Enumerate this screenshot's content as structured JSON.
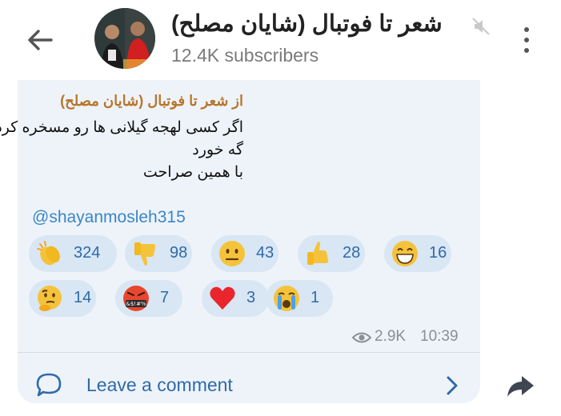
{
  "header": {
    "title": "شعر تا فوتبال (شایان مصلح)",
    "subscribers": "12.4K subscribers"
  },
  "message": {
    "forwarded_from": "از شعر تا فوتبال (شایان مصلح)",
    "lines": [
      "اگر کسی لهجه گیلانی ها رو مسخره کرد",
      "گه خورد",
      "با همین صراحت"
    ],
    "mention": "@shayanmosleh315",
    "reactions": [
      {
        "emoji": "clapping-hands",
        "count": "324"
      },
      {
        "emoji": "thumbs-down",
        "count": "98"
      },
      {
        "emoji": "neutral-face",
        "count": "43"
      },
      {
        "emoji": "thumbs-up",
        "count": "28"
      },
      {
        "emoji": "grinning-face",
        "count": "16"
      },
      {
        "emoji": "thinking-face",
        "count": "14"
      },
      {
        "emoji": "cursing-face",
        "count": "7"
      },
      {
        "emoji": "red-heart",
        "count": "3"
      },
      {
        "emoji": "crying-face",
        "count": "1"
      }
    ],
    "cursing_symbols": "&$!#%",
    "views": "2.9K",
    "time": "10:39"
  },
  "comments": {
    "label": "Leave a comment"
  },
  "colors": {
    "bubble": "#eef3fa",
    "accent_blue": "#2f6aa8",
    "forward_name": "#b8762b",
    "reaction_bg": "#d9e6f4"
  }
}
